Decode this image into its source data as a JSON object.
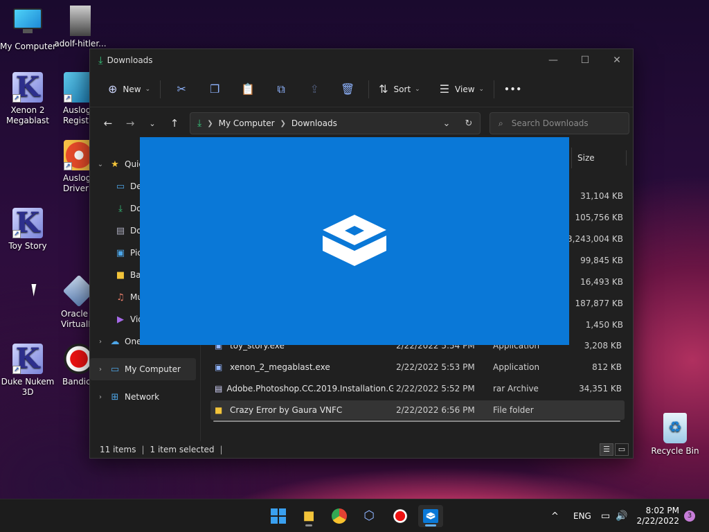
{
  "desktop": {
    "icons": [
      {
        "label": "My Computer",
        "icon": "monitor-icon"
      },
      {
        "label": "adolf-hitler...",
        "icon": "photo-icon"
      },
      {
        "label": "Xenon 2\nMegablast",
        "icon": "k-app-icon"
      },
      {
        "label": "Auslogi\nRegistry",
        "icon": "auslogics-registry-icon"
      },
      {
        "label": "Auslogi\nDriver U",
        "icon": "auslogics-driver-icon"
      },
      {
        "label": "Toy Story",
        "icon": "k-app-icon"
      },
      {
        "label": "Oracle V\nVirtualB",
        "icon": "virtualbox-icon"
      },
      {
        "label": "Duke Nukem\n3D",
        "icon": "k-app-icon"
      },
      {
        "label": "Bandica",
        "icon": "bandicam-icon"
      },
      {
        "label": "Recycle Bin",
        "icon": "recycle-bin-icon"
      }
    ]
  },
  "window": {
    "title": "Downloads",
    "controls": {
      "minimize": "—",
      "maximize": "☐",
      "close": "✕"
    }
  },
  "toolbar": {
    "new_label": "New",
    "sort_label": "Sort",
    "view_label": "View",
    "more_label": "•••"
  },
  "address": {
    "crumbs": [
      "My Computer",
      "Downloads"
    ],
    "search_placeholder": "Search Downloads"
  },
  "navpane": {
    "quick_access": "Quic",
    "items": [
      "De",
      "Do",
      "Do",
      "Pic",
      "Ba",
      "Mu",
      "Vid"
    ],
    "onedrive": "OneDrive",
    "my_computer": "My Computer",
    "network": "Network"
  },
  "columns": {
    "size": "Size"
  },
  "hidden_sizes": [
    "31,104 KB",
    "105,756 KB",
    "3,243,004 KB",
    "99,845 KB",
    "16,493 KB",
    "187,877 KB",
    "1,450 KB"
  ],
  "files": [
    {
      "name": "toy_story.exe",
      "date": "2/22/2022 5:54 PM",
      "type": "Application",
      "size": "3,208 KB"
    },
    {
      "name": "xenon_2_megablast.exe",
      "date": "2/22/2022 5:53 PM",
      "type": "Application",
      "size": "812 KB"
    },
    {
      "name": "Adobe.Photoshop.CC.2019.Installation.G...",
      "date": "2/22/2022 5:52 PM",
      "type": "rar Archive",
      "size": "34,351 KB"
    },
    {
      "name": "Crazy Error by Gaura VNFC",
      "date": "2/22/2022 6:56 PM",
      "type": "File folder",
      "size": ""
    }
  ],
  "status": {
    "items_count": "11 items",
    "selected": "1 item selected"
  },
  "taskbar": {
    "apps": [
      "start-icon",
      "file-explorer-icon",
      "chrome-icon",
      "virtualbox-icon",
      "record-icon",
      "sandbox-icon"
    ],
    "tray": {
      "chevron": "^",
      "lang": "ENG",
      "time": "8:02 PM",
      "date": "2/22/2022",
      "notifications": "3"
    }
  },
  "colors": {
    "splash": "#0a78d7",
    "accent": "#62b0f5",
    "download_green": "#37c47a"
  }
}
